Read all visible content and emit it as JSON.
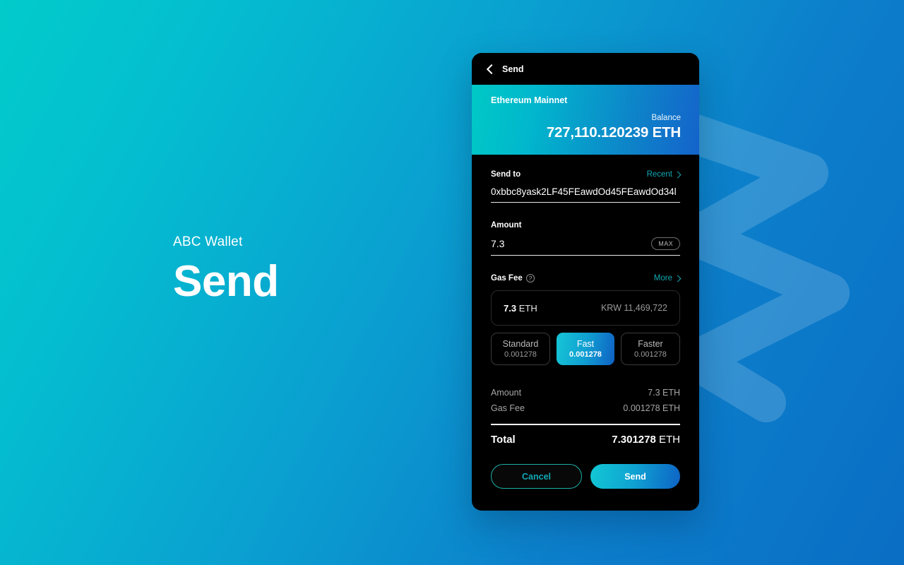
{
  "hero": {
    "kicker": "ABC Wallet",
    "title": "Send"
  },
  "colors": {
    "bg_start": "#02CBCB",
    "bg_end": "#0A6EC4",
    "accent_teal": "#0FA8B4",
    "accent_blue": "#0E63C5",
    "card_bg": "#000000"
  },
  "card": {
    "topbar": {
      "back_icon": "chevron-left-icon",
      "title": "Send"
    },
    "banner": {
      "network": "Ethereum Mainnet",
      "balance_label": "Balance",
      "balance_value": "727,110.120239 ETH"
    },
    "send_to": {
      "label": "Send to",
      "link_label": "Recent",
      "link_icon": "chevron-right-icon",
      "value": "0xbbc8yask2LF45FEawdOd45FEawdOd34l",
      "placeholder": "Enter address"
    },
    "amount": {
      "label": "Amount",
      "value": "7.3",
      "placeholder": "0.0",
      "max_label": "MAX"
    },
    "gas_fee": {
      "label": "Gas Fee",
      "help_icon": "question-circle-icon",
      "link_label": "More",
      "link_icon": "chevron-right-icon",
      "fee_amount": "7.3",
      "fee_unit": "ETH",
      "fee_fiat": "KRW 11,469,722",
      "options": [
        {
          "name": "Standard",
          "value": "0.001278",
          "selected": false
        },
        {
          "name": "Fast",
          "value": "0.001278",
          "selected": true
        },
        {
          "name": "Faster",
          "value": "0.001278",
          "selected": false
        }
      ]
    },
    "summary": {
      "rows": [
        {
          "key": "Amount",
          "value": "7.3 ETH"
        },
        {
          "key": "Gas Fee",
          "value": "0.001278 ETH"
        }
      ],
      "total_label": "Total",
      "total_value": "7.301278",
      "total_unit": "ETH"
    },
    "actions": {
      "cancel_label": "Cancel",
      "send_label": "Send"
    }
  }
}
